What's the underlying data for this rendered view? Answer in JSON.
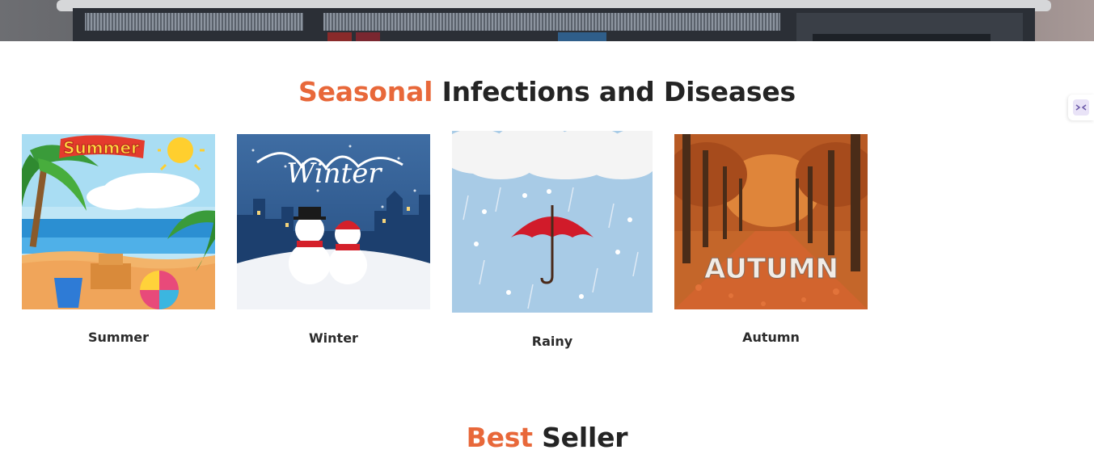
{
  "seasonal": {
    "title_accent": "Seasonal",
    "title_rest": "Infections and Diseases",
    "cards": [
      {
        "label": "Summer",
        "image_text": "Summer"
      },
      {
        "label": "Winter",
        "image_text": "Winter"
      },
      {
        "label": "Rainy"
      },
      {
        "label": "Autumn",
        "image_text": "AUTUMN"
      }
    ]
  },
  "best_seller": {
    "title_accent": "Best",
    "title_rest": "Seller"
  },
  "icons": {
    "side_widget": "minimize-arrows-icon"
  },
  "colors": {
    "accent": "#e8683a",
    "heading": "#242424"
  }
}
